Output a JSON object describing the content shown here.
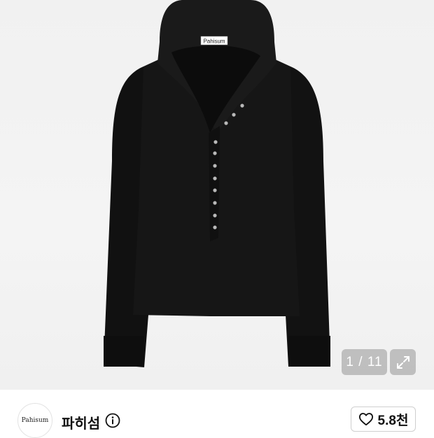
{
  "product_image": {
    "label_text": "Pahisum",
    "description_icon": "black-hooded-henley-top"
  },
  "gallery": {
    "counter": "1 / 11",
    "expand_icon": "expand-arrows-icon"
  },
  "shop": {
    "logo_text": "Pahisum",
    "name": "파히섬",
    "info_icon": "info-icon"
  },
  "like": {
    "icon": "heart-icon",
    "count": "5.8천"
  }
}
